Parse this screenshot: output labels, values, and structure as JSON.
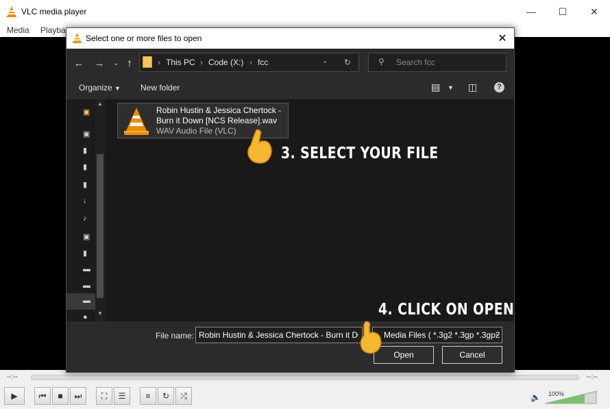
{
  "vlc_window": {
    "title": "VLC media player",
    "menu": [
      "Media",
      "Playba"
    ],
    "time_left": "--:--",
    "time_right": "--:--",
    "volume": "100%"
  },
  "dialog": {
    "title": "Select one or more files to open",
    "breadcrumb": [
      "This PC",
      "Code (X:)",
      "fcc"
    ],
    "search_placeholder": "Search fcc",
    "toolbar": {
      "organize": "Organize",
      "new_folder": "New folder"
    },
    "file": {
      "name": "Robin Hustin & Jessica Chertock - Burn it Down [NCS Release].wav",
      "type": "WAV Audio File (VLC)"
    },
    "file_name_label": "File name:",
    "file_name_value": "Robin Hustin & Jessica Chertock - Burn it D",
    "file_type_filter": "Media Files ( *.3g2 *.3gp *.3gp2",
    "open_button": "Open",
    "cancel_button": "Cancel"
  },
  "annotations": {
    "step3": "3. SELECT YOUR FILE",
    "step4": "4. CLICK ON OPEN"
  },
  "colors": {
    "annotation_hand": "#f5b82e",
    "vlc_orange": "#f08c00"
  }
}
